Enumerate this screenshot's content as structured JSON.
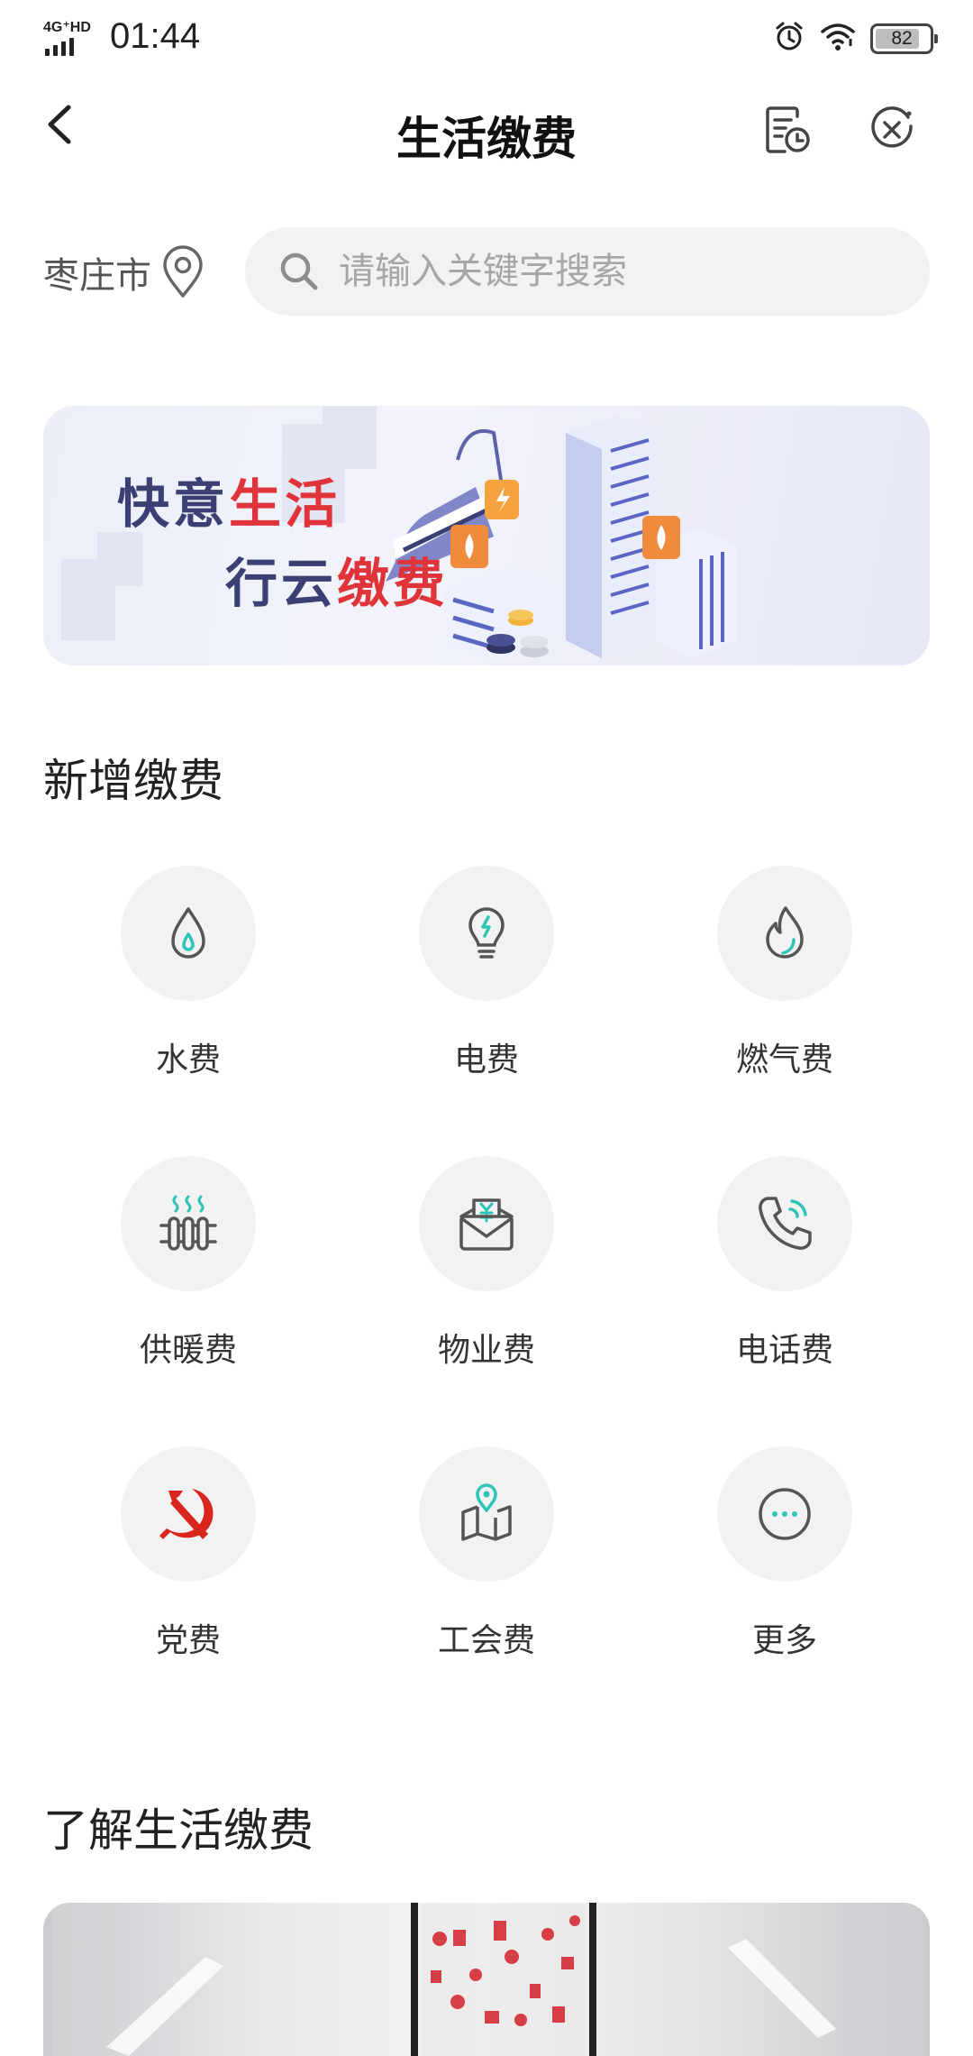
{
  "status_bar": {
    "network": "4G⁺HD",
    "time": "01:44",
    "battery": "82",
    "battery_level": 0.82
  },
  "header": {
    "title": "生活缴费",
    "back_icon": "chevron-left-icon",
    "history_icon": "bill-history-icon",
    "close_icon": "close-circle-icon"
  },
  "location": {
    "city": "枣庄市",
    "icon": "location-pin-icon"
  },
  "search": {
    "placeholder": "请输入关键字搜索",
    "value": ""
  },
  "banner": {
    "line1_a": "快意",
    "line1_b": "生活",
    "line2_a": "行云",
    "line2_b": "缴费"
  },
  "section_add": {
    "title": "新增缴费"
  },
  "services": [
    {
      "label": "水费",
      "icon": "water-drop-icon"
    },
    {
      "label": "电费",
      "icon": "light-bulb-icon"
    },
    {
      "label": "燃气费",
      "icon": "flame-icon"
    },
    {
      "label": "供暖费",
      "icon": "radiator-icon"
    },
    {
      "label": "物业费",
      "icon": "envelope-yuan-icon"
    },
    {
      "label": "电话费",
      "icon": "phone-icon"
    },
    {
      "label": "党费",
      "icon": "hammer-sickle-icon"
    },
    {
      "label": "工会费",
      "icon": "map-pin-icon"
    },
    {
      "label": "更多",
      "icon": "more-icon"
    }
  ],
  "section_learn": {
    "title": "了解生活缴费"
  },
  "colors": {
    "accent_teal": "#2ec4b6",
    "icon_gray": "#555555",
    "banner_red": "#e0343b",
    "banner_navy": "#3b3f73",
    "party_red": "#d9251d"
  }
}
